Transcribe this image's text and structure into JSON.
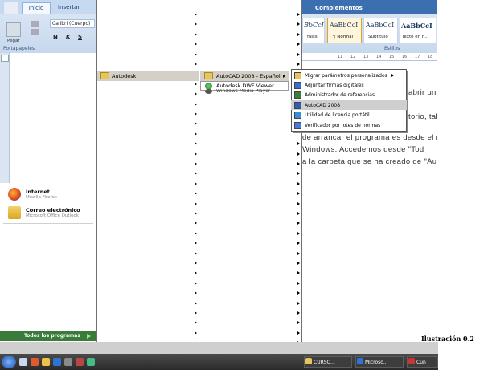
{
  "word": {
    "tabs": [
      "Inicio",
      "Insertar"
    ],
    "tab_complementos": "Complementos",
    "paste_label": "Pegar",
    "clipboard_group": "Portapapeles",
    "font_name": "Calibri (Cuerpo)",
    "format_buttons": [
      "N",
      "K",
      "S"
    ],
    "styles_group": "Estilos",
    "styles": [
      {
        "sample": "BbCcI",
        "name": "fasis"
      },
      {
        "sample": "AaBbCcI",
        "name": "¶ Normal"
      },
      {
        "sample": "AaBbCcI",
        "name": "Subtítulo"
      },
      {
        "sample": "AaBbCcI",
        "name": "Texto en n..."
      }
    ],
    "ruler_numbers": [
      "11",
      "12",
      "13",
      "14",
      "15",
      "16",
      "17",
      "18"
    ],
    "doc_lines": [
      "abrir un pr",
      "torio, tal y c",
      "de arrancar el programa es desde el m",
      "Windows.  Accedemos  desde  \"Tod",
      "a la carpeta que se ha creado de \"Au"
    ]
  },
  "start_menu": {
    "pinned": [
      {
        "title": "Internet",
        "subtitle": "Mozilla Firefox",
        "icon": "firefox-icon"
      },
      {
        "title": "Correo electrónico",
        "subtitle": "Microsoft Office Outlook",
        "icon": "outlook-icon"
      }
    ],
    "all_programs": "Todos los programas"
  },
  "programs_menu": {
    "autodesk": "Autodesk",
    "sub_items": [
      "AutoCAD 2008 - Español",
      "Autodesk DWF Viewer",
      "Windows Media Player"
    ]
  },
  "autocad_submenu": [
    {
      "label": "Migrar parámetros personalizados",
      "arrow": true
    },
    {
      "label": "Adjuntar firmas digitales"
    },
    {
      "label": "Administrador de referencias"
    },
    {
      "label": "AutoCAD 2008",
      "highlight": true
    },
    {
      "label": "Utilidad de licencia portátil"
    },
    {
      "label": "Verificador por lotes de normas"
    }
  ],
  "taskbar": {
    "buttons": [
      "CURSO...",
      "Microso...",
      "Cun"
    ]
  },
  "caption": "Ilustración 0.2",
  "colors": {
    "ribbon": "#c7d8ee",
    "taskbar": "#2b2b2b",
    "menu_highlight": "#d4d0c8"
  }
}
